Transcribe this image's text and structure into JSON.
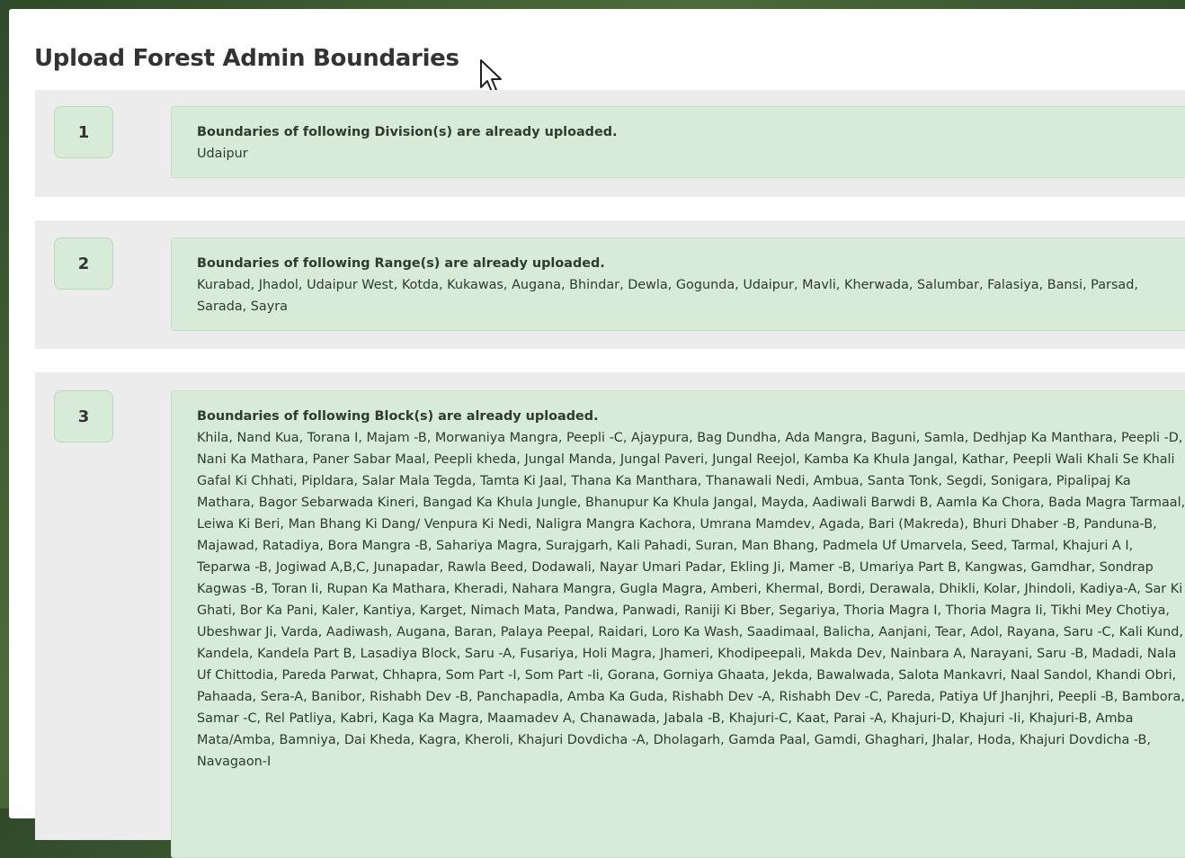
{
  "modal": {
    "title": "Upload Forest Admin Boundaries"
  },
  "sections": [
    {
      "number": "1",
      "heading": "Boundaries of following Division(s) are already uploaded.",
      "items": "Udaipur"
    },
    {
      "number": "2",
      "heading": "Boundaries of following Range(s) are already uploaded.",
      "items": "Kurabad, Jhadol, Udaipur West, Kotda, Kukawas, Augana, Bhindar, Dewla, Gogunda, Udaipur, Mavli, Kherwada, Salumbar, Falasiya, Bansi, Parsad, Sarada, Sayra"
    },
    {
      "number": "3",
      "heading": "Boundaries of following Block(s) are already uploaded.",
      "items": "Khila, Nand Kua, Torana I, Majam -B, Morwaniya Mangra, Peepli -C, Ajaypura, Bag Dundha, Ada Mangra, Baguni, Samla, Dedhjap Ka Manthara, Peepli -D, Nani Ka Mathara, Paner Sabar Maal, Peepli kheda, Jungal Manda, Jungal Paveri, Jungal Reejol, Kamba Ka Khula Jangal, Kathar, Peepli Wali Khali Se Khali Gafal Ki Chhati, Pipldara, Salar Mala Tegda, Tamta Ki Jaal, Thana Ka Manthara, Thanawali Nedi, Ambua, Santa Tonk, Segdi, Sonigara, Pipalipaj Ka Mathara, Bagor Sebarwada Kineri, Bangad Ka Khula Jungle, Bhanupur Ka Khula Jangal, Mayda, Aadiwali Barwdi B, Aamla Ka Chora, Bada Magra Tarmaal, Leiwa Ki Beri, Man Bhang Ki Dang/ Venpura Ki Nedi, Naligra Mangra Kachora, Umrana Mamdev, Agada, Bari (Makreda), Bhuri Dhaber -B, Panduna-B, Majawad, Ratadiya, Bora Mangra -B, Sahariya Magra, Surajgarh, Kali Pahadi, Suran, Man Bhang, Padmela Uf Umarvela, Seed, Tarmal, Khajuri A I, Teparwa -B, Jogiwad A,B,C, Junapadar, Rawla Beed, Dodawali, Nayar Umari Padar, Ekling Ji, Mamer -B, Umariya Part B, Kangwas, Gamdhar, Sondrap Kagwas -B, Toran Ii, Rupan Ka Mathara, Kheradi, Nahara Mangra, Gugla Magra, Amberi, Khermal, Bordi, Derawala, Dhikli, Kolar, Jhindoli, Kadiya-A, Sar Ki Ghati, Bor Ka Pani, Kaler, Kantiya, Karget, Nimach Mata, Pandwa, Panwadi, Raniji Ki Bber, Segariya, Thoria Magra I, Thoria Magra Ii, Tikhi Mey Chotiya, Ubeshwar Ji, Varda, Aadiwash, Augana, Baran, Palaya Peepal, Raidari, Loro Ka Wash, Saadimaal, Balicha, Aanjani, Tear, Adol, Rayana, Saru -C, Kali Kund, Kandela, Kandela Part B, Lasadiya Block, Saru -A, Fusariya, Holi Magra, Jhameri, Khodipeepali, Makda Dev, Nainbara A, Narayani, Saru -B, Madadi, Nala Uf Chittodia, Pareda Parwat, Chhapra, Som Part -I, Som Part -Ii, Gorana, Gorniya Ghaata, Jekda, Bawalwada, Salota Mankavri, Naal Sandol, Khandi Obri, Pahaada, Sera-A, Banibor, Rishabh Dev -B, Panchapadla, Amba Ka Guda, Rishabh Dev -A, Rishabh Dev -C, Pareda, Patiya Uf Jhanjhri, Peepli -B, Bambora, Samar -C, Rel Patliya, Kabri, Kaga Ka Magra, Maamadev A, Chanawada, Jabala -B, Khajuri-C, Kaat, Parai -A, Khajuri-D, Khajuri -Ii, Khajuri-B, Amba Mata/Amba, Bamniya, Dai Kheda, Kagra, Kheroli, Khajuri Dovdicha -A, Dholagarh, Gamda Paal, Gamdi, Ghaghari, Jhalar, Hoda, Khajuri Dovdicha -B, Navagaon-I"
    }
  ]
}
